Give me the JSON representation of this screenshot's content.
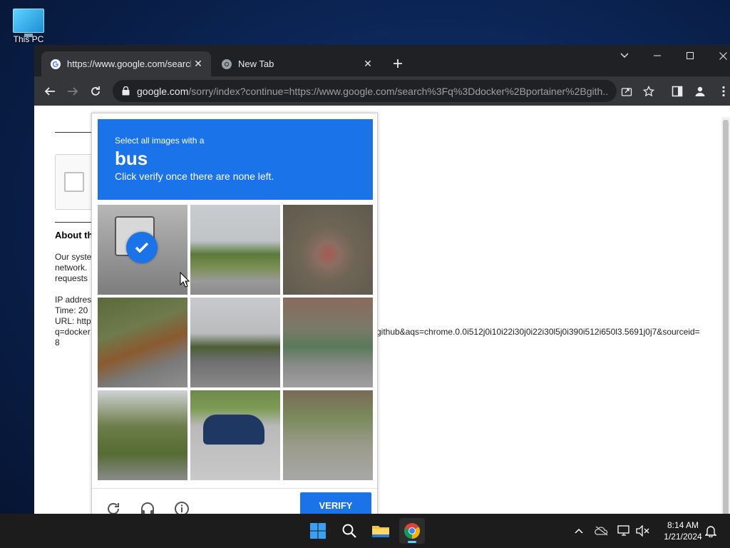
{
  "desktop": {
    "icon_label": "This PC"
  },
  "browser": {
    "tabs": [
      {
        "title": "https://www.google.com/search?",
        "favicon": "google-g-icon",
        "active": true
      },
      {
        "title": "New Tab",
        "favicon": "chrome-icon",
        "active": false
      }
    ],
    "url_domain": "google.com",
    "url_path": "/sorry/index?continue=https://www.google.com/search%3Fq%3Ddocker%2Bportainer%2Bgith..."
  },
  "page": {
    "about_heading": "About th",
    "lines": [
      "Our syste",
      "network.",
      "requests",
      "",
      "IP addres",
      "Time: 20",
      "URL: http",
      "q=docker",
      "8"
    ],
    "overflow_text": "github&aqs=chrome.0.0i512j0i10i22i30j0i22i30l5j0i390i512i650l3.5691j0j7&sourceid="
  },
  "captcha": {
    "instruction_line1": "Select all images with a",
    "target": "bus",
    "instruction_line3": "Click verify once there are none left.",
    "tiles": [
      {
        "desc": "bus on road",
        "selected": true
      },
      {
        "desc": "trees and parking lot",
        "selected": false
      },
      {
        "desc": "fire hydrant",
        "selected": false
      },
      {
        "desc": "school bus by trees",
        "selected": false
      },
      {
        "desc": "road with trees",
        "selected": false
      },
      {
        "desc": "bus and traffic light",
        "selected": false
      },
      {
        "desc": "street with trees",
        "selected": false
      },
      {
        "desc": "blue car",
        "selected": false
      },
      {
        "desc": "sidewalk and house",
        "selected": false
      }
    ],
    "verify_label": "VERIFY",
    "footer_icons": [
      "reload-icon",
      "audio-icon",
      "info-icon"
    ]
  },
  "taskbar": {
    "apps": [
      "windows-start-icon",
      "search-icon",
      "file-explorer-icon",
      "chrome-icon"
    ],
    "time": "8:14 AM",
    "date": "1/21/2024"
  },
  "colors": {
    "captcha_blue": "#1a73e8",
    "chrome_dark": "#202124",
    "chrome_toolbar": "#35363a"
  }
}
